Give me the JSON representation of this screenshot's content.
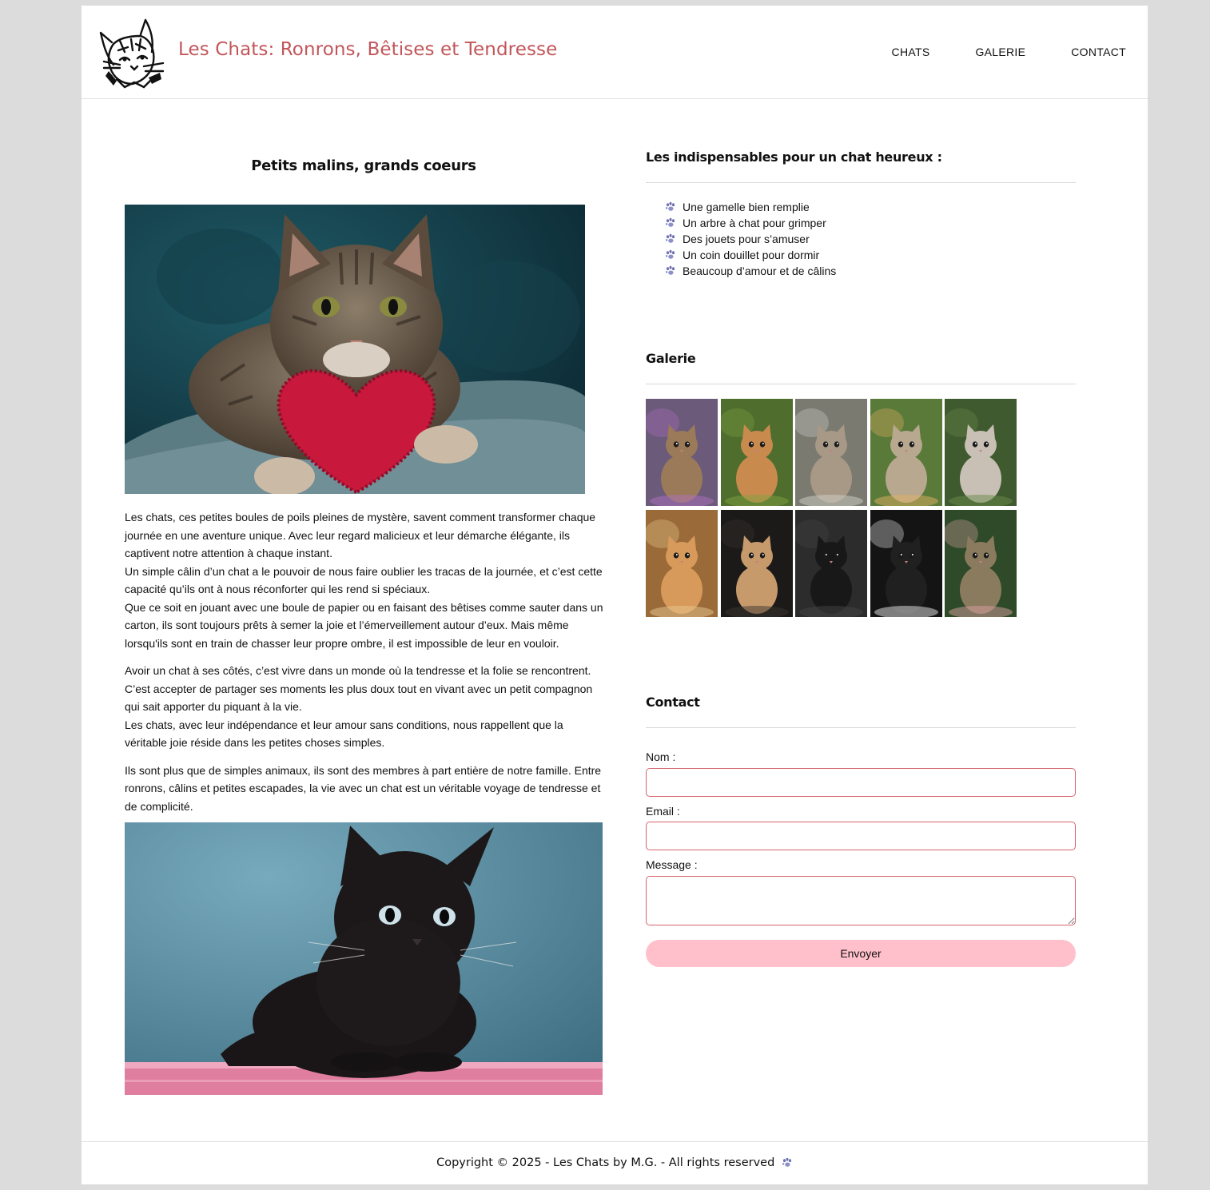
{
  "header": {
    "title": "Les Chats: Ronrons, Bêtises et Tendresse",
    "nav": [
      "CHATS",
      "GALERIE",
      "CONTACT"
    ]
  },
  "article": {
    "title": "Petits malins, grands coeurs",
    "paragraphs": [
      [
        "Les chats, ces petites boules de poils pleines de mystère, savent comment transformer chaque journée en une aventure unique. Avec leur regard malicieux et leur démarche élégante, ils captivent notre attention à chaque instant.",
        "Un simple câlin d’un chat a le pouvoir de nous faire oublier les tracas de la journée, et c’est cette capacité qu’ils ont à nous réconforter qui les rend si spéciaux.",
        "Que ce soit en jouant avec une boule de papier ou en faisant des bêtises comme sauter dans un carton, ils sont toujours prêts à semer la joie et l’émerveillement autour d’eux. Mais même lorsqu'ils sont en train de chasser leur propre ombre, il est impossible de leur en vouloir."
      ],
      [
        "Avoir un chat à ses côtés, c’est vivre dans un monde où la tendresse et la folie se rencontrent. C’est accepter de partager ses moments les plus doux tout en vivant avec un petit compagnon qui sait apporter du piquant à la vie.",
        "Les chats, avec leur indépendance et leur amour sans conditions, nous rappellent que la véritable joie réside dans les petites choses simples."
      ],
      [
        "Ils sont plus que de simples animaux, ils sont des membres à part entière de notre famille. Entre ronrons, câlins et petites escapades, la vie avec un chat est un véritable voyage de tendresse et de complicité."
      ]
    ]
  },
  "essentials": {
    "title": "Les indispensables pour un chat heureux :",
    "items": [
      "Une gamelle bien remplie",
      "Un arbre à chat pour grimper",
      "Des jouets pour s’amuser",
      "Un coin douillet pour dormir",
      "Beaucoup d’amour et de câlins"
    ]
  },
  "gallery": {
    "title": "Galerie",
    "thumbs": [
      {
        "bg": "#6b5a7a",
        "fur": "#9a7a58",
        "accent": "#b06fc0"
      },
      {
        "bg": "#4f6e2e",
        "fur": "#c98a4e",
        "accent": "#7fa040"
      },
      {
        "bg": "#7a7a70",
        "fur": "#a89886",
        "accent": "#cfcfc8"
      },
      {
        "bg": "#5a7a3a",
        "fur": "#b8a890",
        "accent": "#e0b060"
      },
      {
        "bg": "#3f5a2e",
        "fur": "#c8c0b4",
        "accent": "#6a8a4a"
      },
      {
        "bg": "#9a6a38",
        "fur": "#d89a5a",
        "accent": "#e8c890"
      },
      {
        "bg": "#1c1a18",
        "fur": "#c79a6c",
        "accent": "#3a3430"
      },
      {
        "bg": "#2c2c2c",
        "fur": "#181818",
        "accent": "#444444"
      },
      {
        "bg": "#141414",
        "fur": "#202020",
        "accent": "#e8e8e8"
      },
      {
        "bg": "#2e4a28",
        "fur": "#8a7a5e",
        "accent": "#d8a0a0"
      }
    ]
  },
  "contact": {
    "title": "Contact",
    "name_label": "Nom :",
    "email_label": "Email :",
    "message_label": "Message :",
    "submit_label": "Envoyer"
  },
  "footer": {
    "text": "Copyright © 2025 - Les Chats by M.G. - All rights reserved"
  },
  "colors": {
    "title": "#c2565a",
    "field_border": "#d4636d",
    "button": "#ffc0cb"
  }
}
